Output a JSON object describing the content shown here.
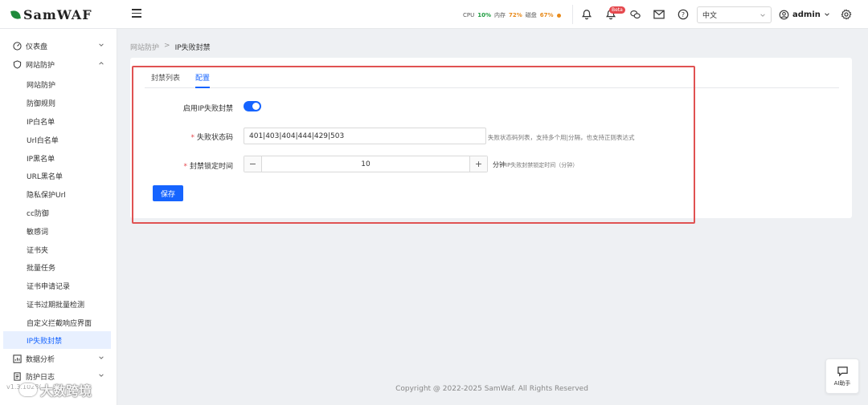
{
  "header": {
    "logo_text": "SamWAF",
    "stats": {
      "cpu_label": "CPU",
      "cpu_value": "10%",
      "mem_label": "内存",
      "mem_value": "72%",
      "disk_label": "磁盘",
      "disk_value": "67%"
    },
    "notify_badge": "Beta",
    "language": "中文",
    "user": "admin"
  },
  "sidebar": {
    "dashboard": "仪表盘",
    "protection": "网站防护",
    "items": [
      "网站防护",
      "防御规则",
      "IP白名单",
      "Url白名单",
      "IP黑名单",
      "URL黑名单",
      "隐私保护Url",
      "cc防御",
      "敏感词",
      "证书夹",
      "批量任务",
      "证书申请记录",
      "证书过期批量检测",
      "自定义拦截响应界面",
      "IP失败封禁"
    ],
    "data_analysis": "数据分析",
    "protect_log": "防护日志",
    "bottom_text": "v1.3.1028(...",
    "watermark": "大数跨境"
  },
  "breadcrumb": {
    "parent": "网站防护",
    "sep": ">",
    "current": "IP失败封禁"
  },
  "tabs": [
    "封禁列表",
    "配置"
  ],
  "form": {
    "enable_label": "启用IP失败封禁",
    "status_label": "失败状态码",
    "status_value": "401|403|404|444|429|503",
    "status_hint": "失败状态码列表，支持多个用|分隔，也支持正则表达式",
    "lock_label": "封禁锁定时间",
    "lock_value": "10",
    "unit": "分钟",
    "unit_hint": "IP失败封禁锁定时间（分钟）",
    "save": "保存",
    "req_mark": "*"
  },
  "footer": {
    "copyright": "Copyright @ 2022-2025 SamWaf. All Rights Reserved"
  },
  "ai_button": "AI助手",
  "colors": {
    "accent": "#1664ff",
    "highlight": "#e05252"
  }
}
